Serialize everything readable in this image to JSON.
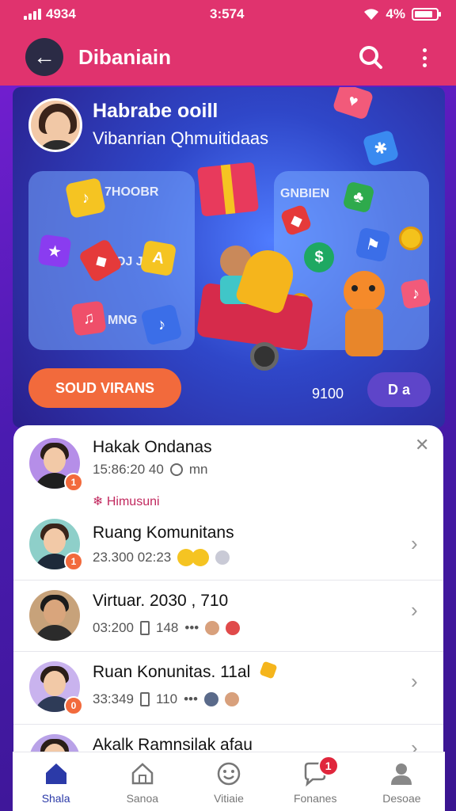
{
  "status_bar": {
    "left_text": "4934",
    "center_time": "3:574",
    "right_text": "4%"
  },
  "header": {
    "title": "Dibaniain"
  },
  "hero": {
    "title": "Habrabe ooill",
    "subtitle": "Vibanrian Qhmuitidaas",
    "panel_left_label_top": "7HOOBR",
    "panel_left_label_mid": "OJ JUR",
    "panel_left_label_bottom": "MNG",
    "panel_right_label": "GNBIEN",
    "cta": "SOUD VIRANS",
    "count": "9100",
    "pill": "D a"
  },
  "list": {
    "items": [
      {
        "title": "Hakak Ondanas",
        "meta": "15:86:20 40",
        "meta_extra": "mn",
        "badge": "1",
        "tag": "Himusuni"
      },
      {
        "title": "Ruang Komunitans",
        "meta": "23.300  02:23",
        "badge": "1"
      },
      {
        "title": "Virtuar. 2030 , 710",
        "meta": "03:200",
        "meta_b": "148",
        "meta_dots": "•••"
      },
      {
        "title": "Ruan Konunitas. 11al",
        "meta": "33:349",
        "meta_b": "110",
        "meta_dots": "•••",
        "badge": "0"
      },
      {
        "title": "Akalk Ramnsilak afau"
      }
    ]
  },
  "nav": {
    "items": [
      {
        "label": "Shala",
        "icon": "home-icon",
        "active": true
      },
      {
        "label": "Sanoa",
        "icon": "house-outline-icon"
      },
      {
        "label": "Vitiaie",
        "icon": "smiley-icon"
      },
      {
        "label": "Fonanes",
        "icon": "chat-icon",
        "badge": "1"
      },
      {
        "label": "Desoae",
        "icon": "profile-icon"
      }
    ]
  },
  "colors": {
    "header": "#e0336e",
    "accent": "#f26a3c",
    "nav_active": "#2b3aa8"
  }
}
